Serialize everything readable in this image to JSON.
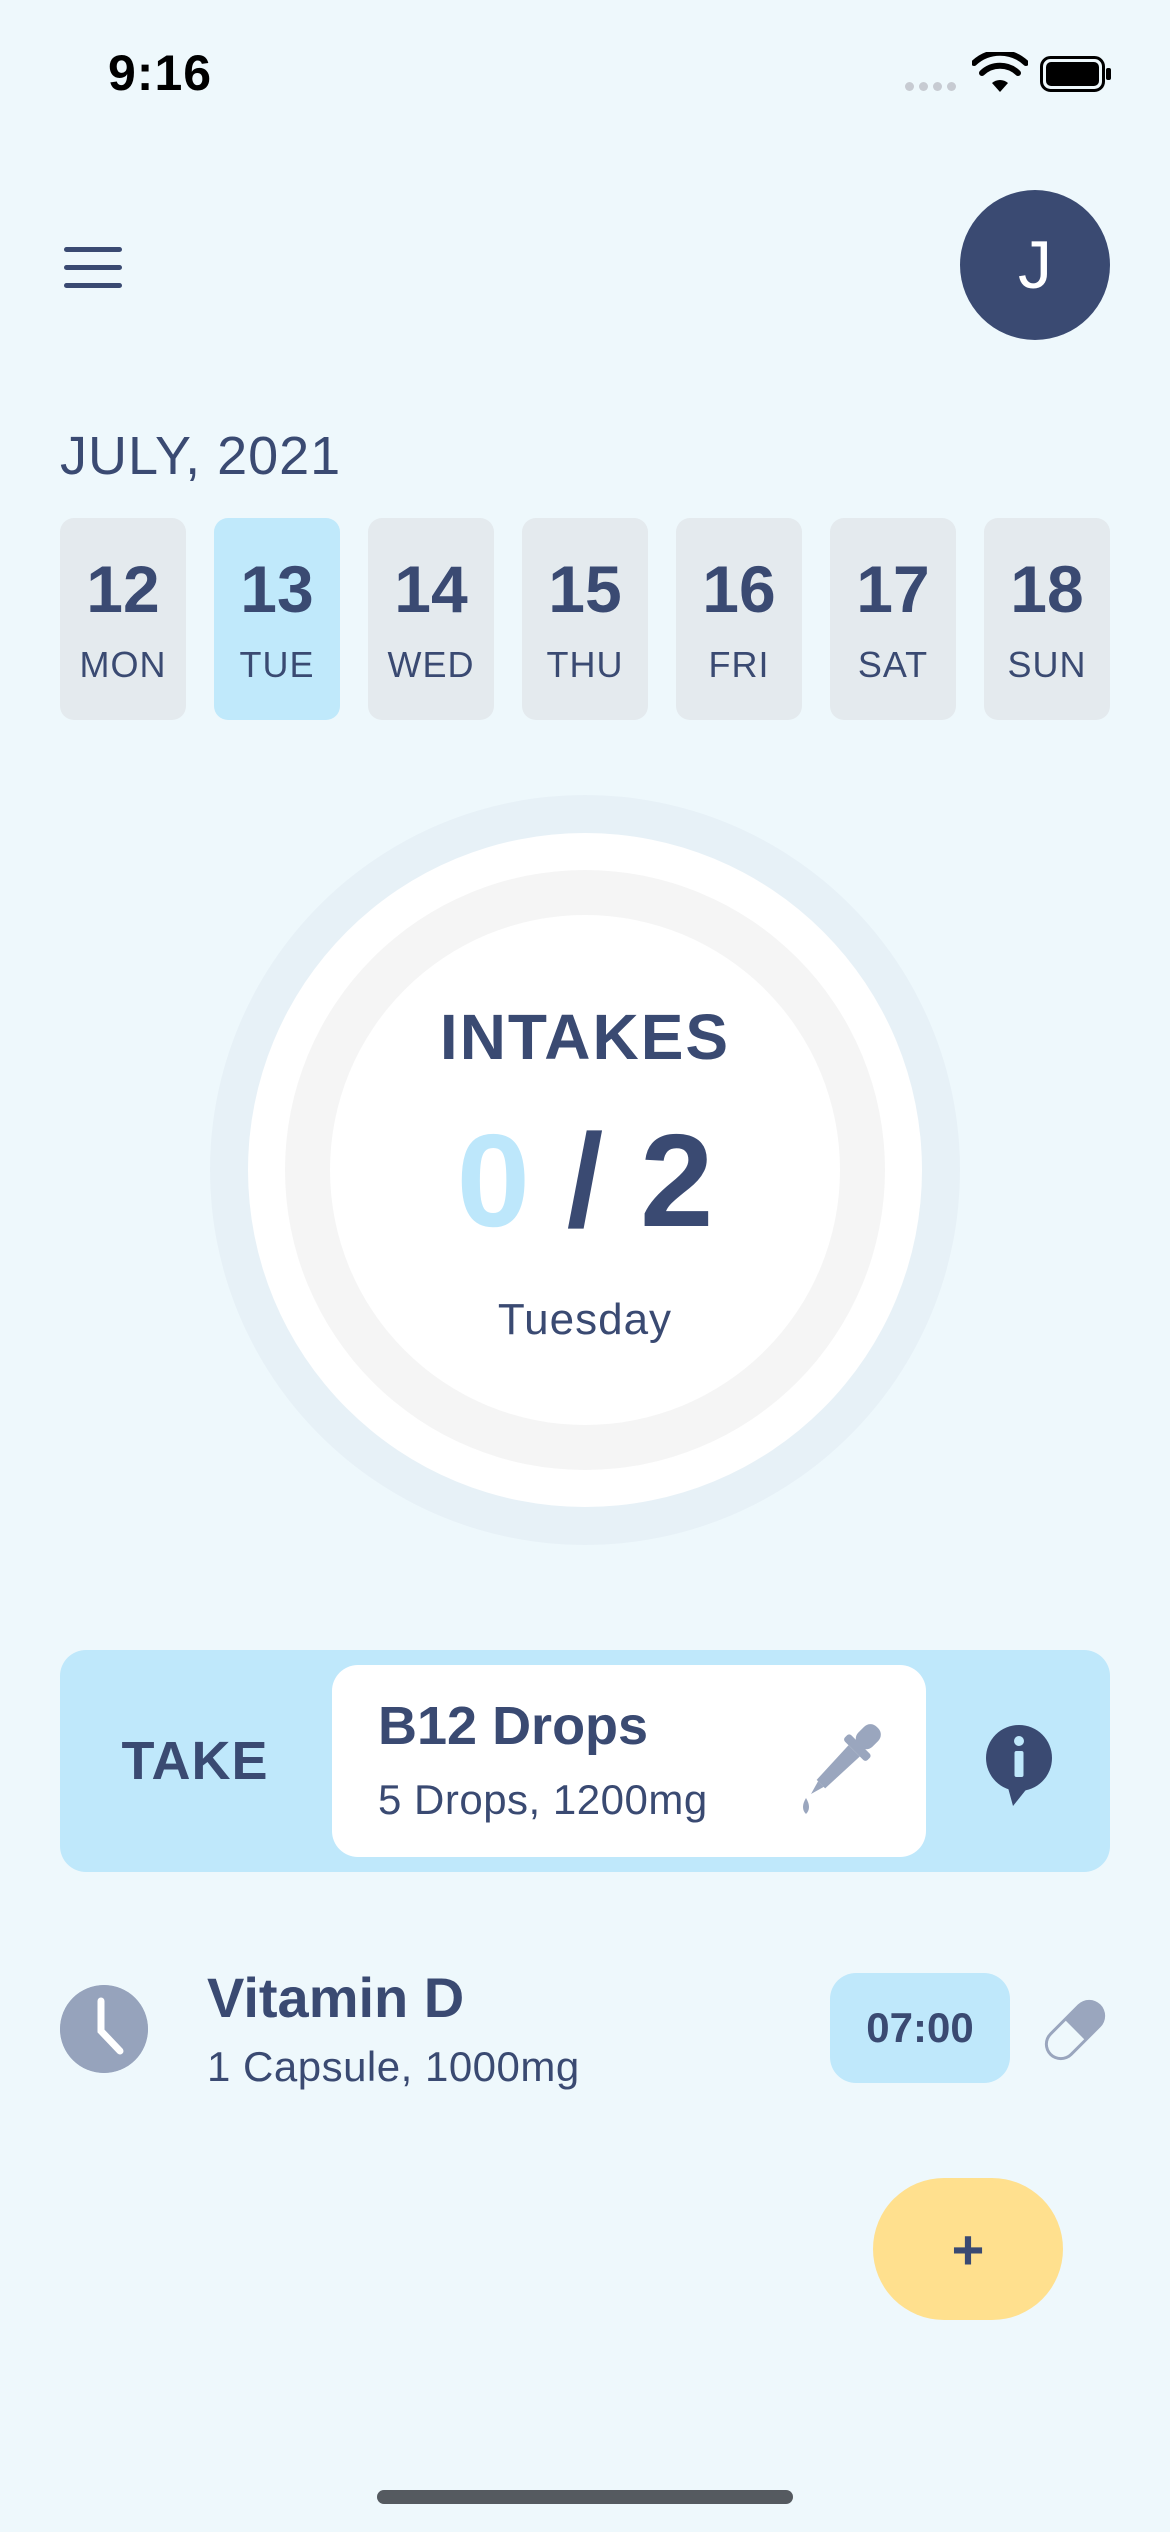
{
  "status_bar": {
    "time": "9:16"
  },
  "header": {
    "avatar_initial": "J",
    "month": "JULY, 2021"
  },
  "days": [
    {
      "num": "12",
      "weekday": "MON",
      "selected": false
    },
    {
      "num": "13",
      "weekday": "TUE",
      "selected": true
    },
    {
      "num": "14",
      "weekday": "WED",
      "selected": false
    },
    {
      "num": "15",
      "weekday": "THU",
      "selected": false
    },
    {
      "num": "16",
      "weekday": "FRI",
      "selected": false
    },
    {
      "num": "17",
      "weekday": "SAT",
      "selected": false
    },
    {
      "num": "18",
      "weekday": "SUN",
      "selected": false
    }
  ],
  "intakes": {
    "label": "INTAKES",
    "taken": "0",
    "separator": "/",
    "total": "2",
    "day": "Tuesday"
  },
  "take_card": {
    "button_label": "TAKE",
    "med_name": "B12 Drops",
    "med_dose": "5 Drops, 1200mg",
    "icon": "dropper-icon",
    "info_icon": "info-icon"
  },
  "scheduled": [
    {
      "name": "Vitamin D",
      "dose": "1 Capsule, 1000mg",
      "time": "07:00",
      "icon": "capsule-icon"
    }
  ],
  "fab": {
    "label": "+"
  },
  "colors": {
    "primary": "#3A4A72",
    "accent": "#BFE8FB",
    "background": "#EEF8FC",
    "fab": "#FFE08E"
  }
}
